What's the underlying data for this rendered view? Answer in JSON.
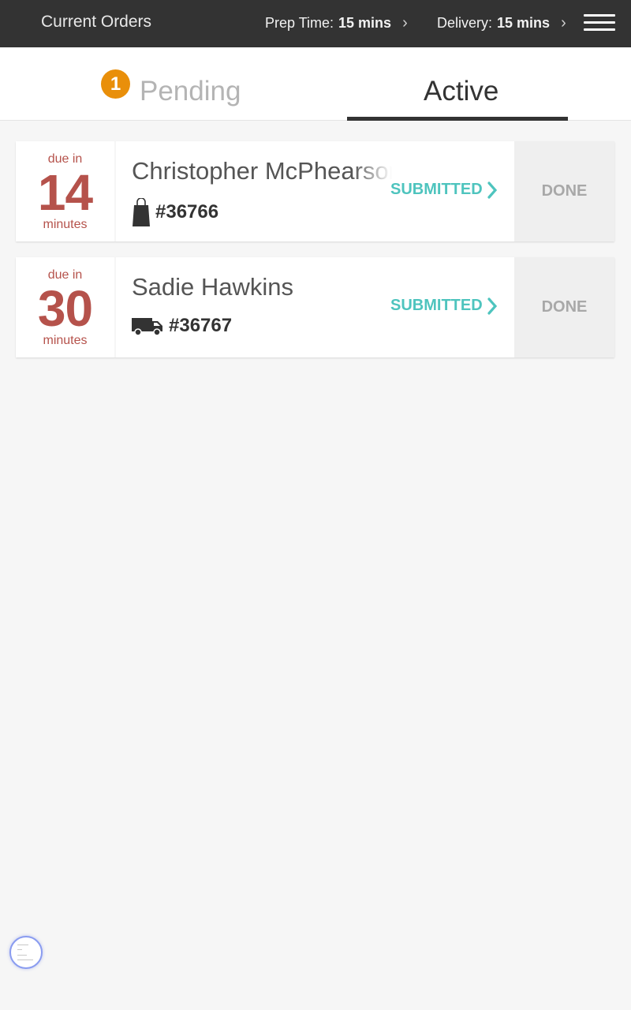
{
  "header": {
    "title": "Current Orders",
    "prep_time": {
      "label": "Prep Time:",
      "value": "15 mins"
    },
    "delivery": {
      "label": "Delivery:",
      "value": "15 mins"
    },
    "menu_icon": "hamburger-menu-icon"
  },
  "tabs": [
    {
      "label": "Pending",
      "badge": "1",
      "active": false
    },
    {
      "label": "Active",
      "active": true
    }
  ],
  "orders": [
    {
      "due_prefix": "due in",
      "due_minutes": "14",
      "due_suffix": "minutes",
      "customer": "Christopher McPhearson",
      "type_icon": "shopping-bag-icon",
      "order_number": "#36766",
      "status": "SUBMITTED",
      "action": "DONE"
    },
    {
      "due_prefix": "due in",
      "due_minutes": "30",
      "due_suffix": "minutes",
      "customer": "Sadie Hawkins",
      "type_icon": "delivery-van-icon",
      "order_number": "#36767",
      "status": "SUBMITTED",
      "action": "DONE"
    }
  ],
  "colors": {
    "header_bg": "#333333",
    "badge": "#e98f0a",
    "due": "#b5524b",
    "status": "#4ec4be",
    "done_text": "#a8a8a8"
  }
}
